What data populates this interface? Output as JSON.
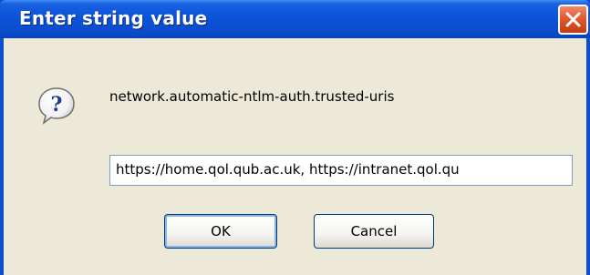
{
  "dialog": {
    "title": "Enter string value",
    "close_icon": "close-icon",
    "icon": "question-icon",
    "pref_name": "network.automatic-ntlm-auth.trusted-uris",
    "input_value": "https://home.qol.qub.ac.uk, https://intranet.qol.qu",
    "ok_label": "OK",
    "cancel_label": "Cancel"
  },
  "colors": {
    "titlebar": "#0b53d8",
    "client_bg": "#ece9d8",
    "close_button": "#e2582f",
    "button_border": "#003c74"
  }
}
